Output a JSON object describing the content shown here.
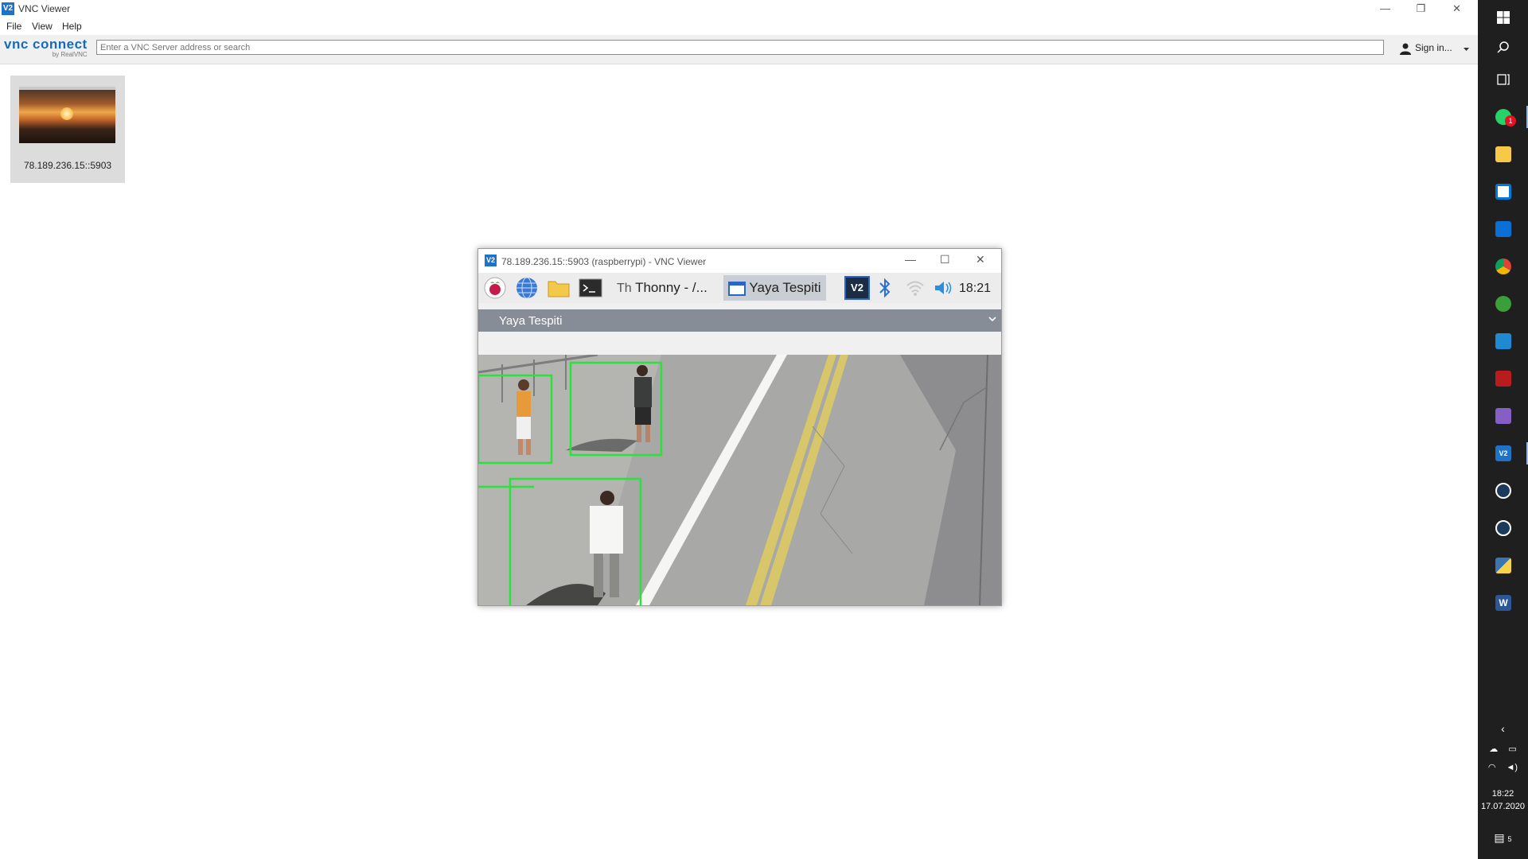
{
  "app": {
    "title": "VNC Viewer",
    "menu": [
      "File",
      "View",
      "Help"
    ],
    "logo": {
      "brand": "vnc connect",
      "sub": "by RealVNC"
    },
    "search_placeholder": "Enter a VNC Server address or search",
    "sign_in": "Sign in...",
    "window_controls": {
      "minimize": "—",
      "restore": "❐",
      "close": "✕"
    }
  },
  "address_book": [
    {
      "label": "78.189.236.15::5903"
    }
  ],
  "remote_window": {
    "title": "78.189.236.15::5903 (raspberrypi) - VNC Viewer",
    "controls": {
      "minimize": "—",
      "maximize": "☐",
      "close": "✕"
    },
    "panel": {
      "tasks": [
        {
          "label": "Thonny  -  /...",
          "active": false
        },
        {
          "label": "Yaya Tespiti",
          "active": true
        }
      ],
      "clock": "18:21"
    },
    "app_window": {
      "title": "Yaya Tespiti"
    }
  },
  "taskbar": {
    "notification_badge": "1",
    "clock_time": "18:22",
    "clock_date": "17.07.2020",
    "action_center_badge": "5",
    "colors": {
      "background": "#1f1f1f",
      "running_indicator": "#9db9de"
    }
  },
  "colors": {
    "detection_box": "#29e33a",
    "vnc_blue": "#1e73c8",
    "app_header": "#868d96"
  }
}
